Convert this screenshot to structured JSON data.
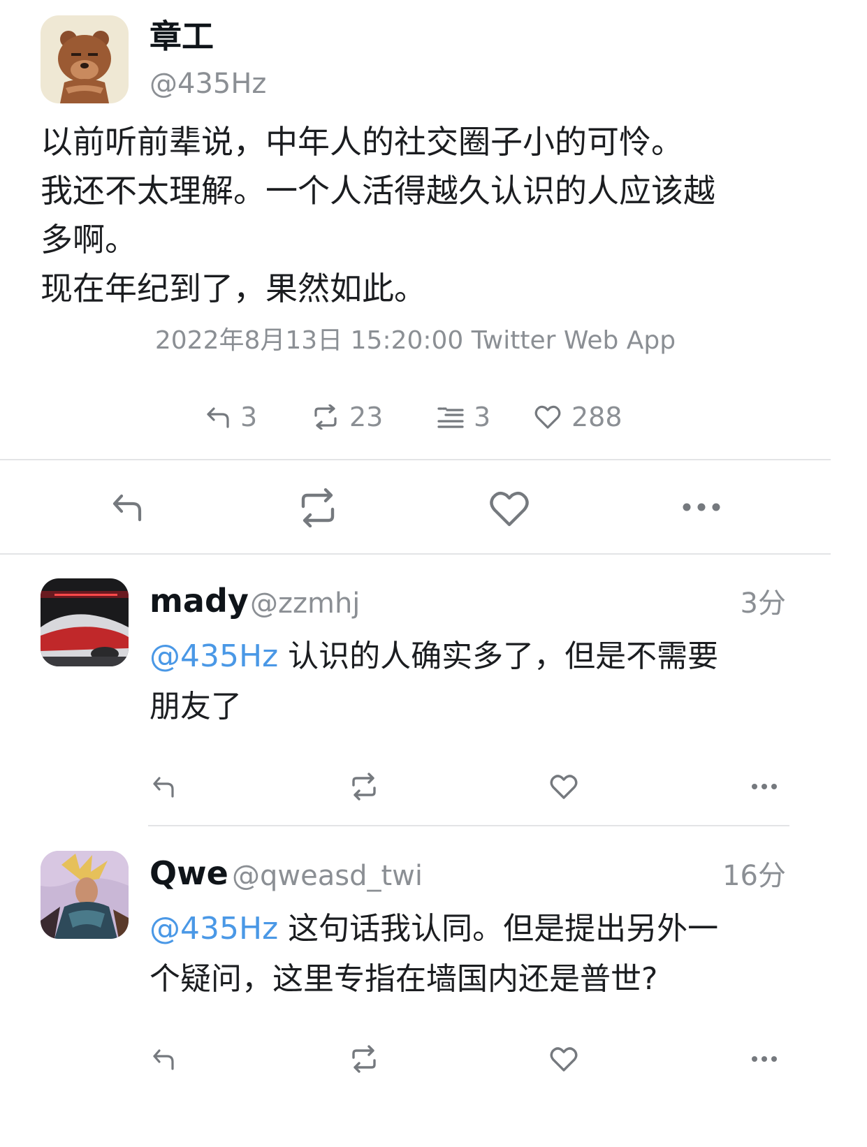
{
  "main_tweet": {
    "author_name": "章工",
    "author_handle": "@435Hz",
    "text": "以前听前辈说，中年人的社交圈子小的可怜。\n我还不太理解。一个人活得越久认识的人应该越\n多啊。\n现在年纪到了，果然如此。",
    "meta": "2022年8月13日 15:20:00 Twitter Web App",
    "stats": {
      "replies": "3",
      "retweets": "23",
      "quotes": "3",
      "likes": "288"
    }
  },
  "replies": [
    {
      "author_name": "mady",
      "author_handle": "@zzmhj",
      "time": "3分",
      "mention": "@435Hz",
      "text": " 认识的人确实多了，但是不需要\n朋友了"
    },
    {
      "author_name": "Qwe",
      "author_handle": "@qweasd_twi",
      "time": "16分",
      "mention": "@435Hz",
      "text": " 这句话我认同。但是提出另外一\n个疑问，这里专指在墙国内还是普世?"
    }
  ],
  "icons": {
    "reply": "reply-icon",
    "retweet": "retweet-icon",
    "quote": "quote-icon",
    "like": "heart-icon",
    "more": "more-icon"
  },
  "colors": {
    "mention": "#4a98e6",
    "secondary_text": "#8b8f94",
    "icon": "#75797e",
    "divider": "#e3e4e6"
  }
}
